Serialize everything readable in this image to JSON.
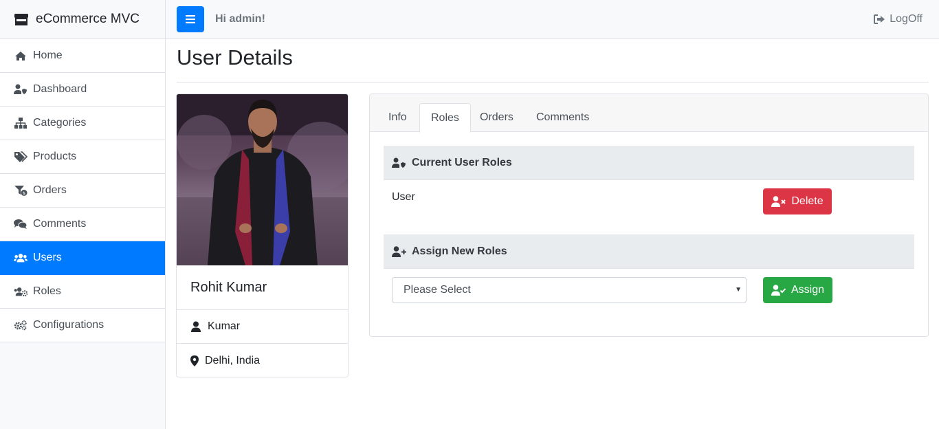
{
  "app": {
    "brand": "eCommerce MVC",
    "brand_icon": "store-icon"
  },
  "sidebar": {
    "items": [
      {
        "label": "Home",
        "icon": "home-icon",
        "active": false
      },
      {
        "label": "Dashboard",
        "icon": "user-shield-icon",
        "active": false
      },
      {
        "label": "Categories",
        "icon": "sitemap-icon",
        "active": false
      },
      {
        "label": "Products",
        "icon": "tags-icon",
        "active": false
      },
      {
        "label": "Orders",
        "icon": "funnel-dollar-icon",
        "active": false
      },
      {
        "label": "Comments",
        "icon": "comments-icon",
        "active": false
      },
      {
        "label": "Users",
        "icon": "users-icon",
        "active": true
      },
      {
        "label": "Roles",
        "icon": "users-cog-icon",
        "active": false
      },
      {
        "label": "Configurations",
        "icon": "cogs-icon",
        "active": false
      }
    ]
  },
  "topbar": {
    "greeting": "Hi admin!",
    "logoff": "LogOff"
  },
  "page": {
    "title": "User Details"
  },
  "profile": {
    "name": "Rohit Kumar",
    "surname": "Kumar",
    "location": "Delhi, India"
  },
  "tabs": {
    "items": [
      "Info",
      "Roles",
      "Orders",
      "Comments"
    ],
    "active": "Roles"
  },
  "roles": {
    "current_title": "Current User Roles",
    "current_roles": [
      "User"
    ],
    "delete_label": "Delete",
    "assign_title": "Assign New Roles",
    "select_placeholder": "Please Select",
    "assign_label": "Assign"
  },
  "colors": {
    "primary": "#007bff",
    "danger": "#dc3545",
    "success": "#28a745"
  }
}
